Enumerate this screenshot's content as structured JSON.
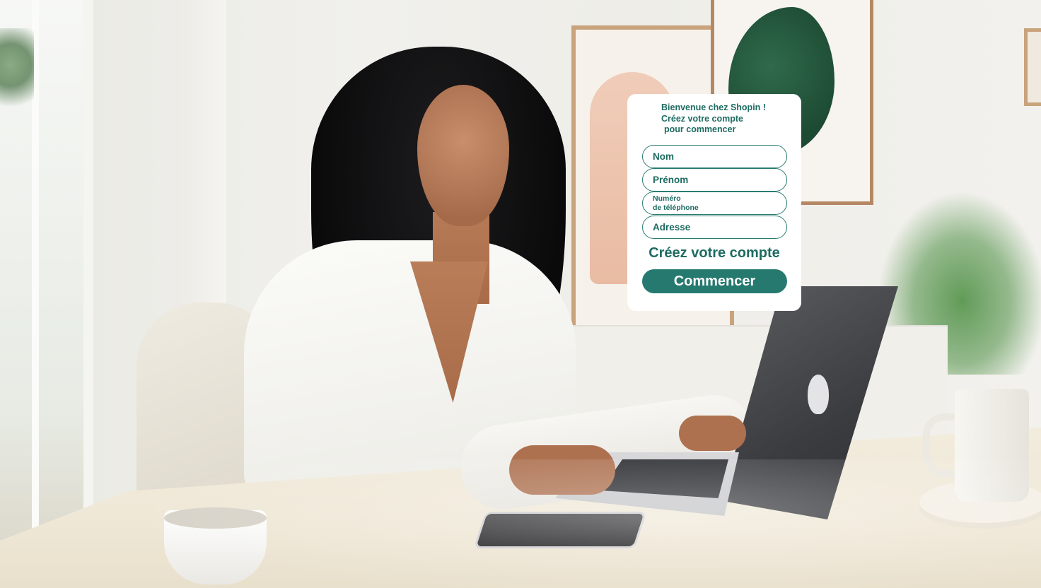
{
  "signup": {
    "welcome_line1": "Bienvenue chez Shopin !",
    "welcome_line2": "Créez votre compte",
    "welcome_line3": "pour commencer",
    "fields": {
      "nom": "Nom",
      "prenom": "Prénom",
      "telephone_line1": "Numéro",
      "telephone_line2": "de téléphone",
      "adresse": "Adresse"
    },
    "create_title": "Créez votre compte",
    "start_button": "Commencer"
  },
  "colors": {
    "accent": "#26796f",
    "text_accent": "#1d6b61",
    "card_background": "#ffffff"
  }
}
